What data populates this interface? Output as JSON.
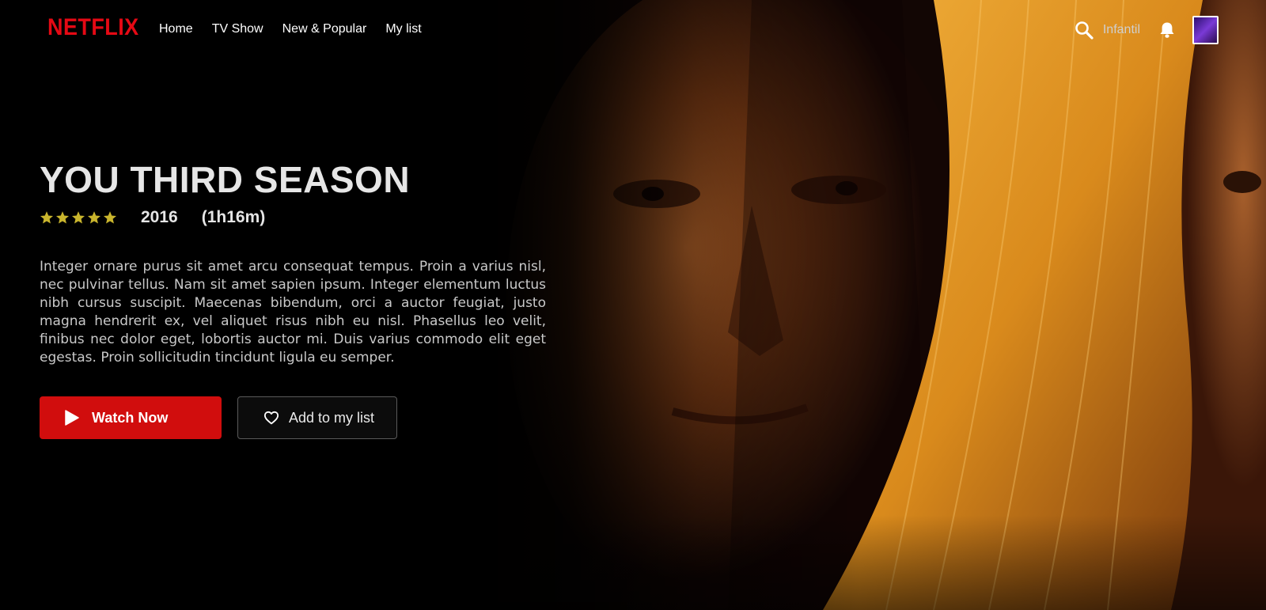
{
  "brand": {
    "logo_text": "NETFLIX",
    "color": "#e50914"
  },
  "nav": {
    "links": [
      {
        "label": "Home"
      },
      {
        "label": "TV Show"
      },
      {
        "label": "New & Popular"
      },
      {
        "label": "My list"
      }
    ],
    "profile_name": "Infantil",
    "icons": [
      "search-icon",
      "bell-icon",
      "avatar"
    ]
  },
  "hero": {
    "title": "YOU THIRD SEASON",
    "rating_stars": 5,
    "star_color": "#c9b52d",
    "year": "2016",
    "duration": "(1h16m)",
    "description": "Integer ornare purus sit amet arcu consequat tempus. Proin a varius nisl, nec pulvinar tellus. Nam sit amet sapien ipsum. Integer elementum luctus nibh cursus suscipit. Maecenas bibendum, orci a auctor feugiat, justo magna hendrerit ex, vel aliquet risus nibh eu nisl. Phasellus leo velit, finibus nec dolor eget, lobortis auctor mi. Duis varius commodo elit eget egestas. Proin sollicitudin tincidunt ligula eu semper.",
    "buttons": {
      "watch_label": "Watch Now",
      "watch_color": "#d10d0d",
      "list_label": "Add to my list"
    }
  }
}
